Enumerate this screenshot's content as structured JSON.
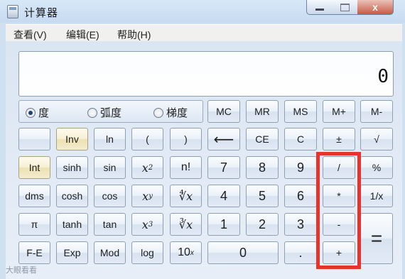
{
  "window": {
    "title": "计算器",
    "controls": {
      "minimize": "",
      "maximize": "",
      "close": "x"
    }
  },
  "menu": [
    "查看(V)",
    "编辑(E)",
    "帮助(H)"
  ],
  "display": {
    "value": "0"
  },
  "mode": {
    "options": [
      "度",
      "弧度",
      "梯度"
    ],
    "selected": "度"
  },
  "memory_row": [
    "MC",
    "MR",
    "MS",
    "M+",
    "M-"
  ],
  "keys": {
    "blank": "",
    "inv": "Inv",
    "ln": "ln",
    "lparen": "(",
    "rparen": ")",
    "backspace": "⟵",
    "ce": "CE",
    "c": "C",
    "plusminus": "±",
    "sqrt": "√",
    "int": "Int",
    "sinh": "sinh",
    "sin": "sin",
    "x2": "x",
    "x2_sup": "2",
    "nfact": "n!",
    "d7": "7",
    "d8": "8",
    "d9": "9",
    "divide": "/",
    "percent": "%",
    "dms": "dms",
    "cosh": "cosh",
    "cos": "cos",
    "xy": "x",
    "xy_sup": "y",
    "yroot": "∜x",
    "d4": "4",
    "d5": "5",
    "d6": "6",
    "multiply": "*",
    "reciprocal": "1/x",
    "pi": "π",
    "tanh": "tanh",
    "tan": "tan",
    "x3": "x",
    "x3_sup": "3",
    "cuberoot": "∛x",
    "d1": "1",
    "d2": "2",
    "d3": "3",
    "minus": "-",
    "equals": "=",
    "fe": "F-E",
    "exp": "Exp",
    "mod": "Mod",
    "log": "log",
    "tenx": "10",
    "tenx_sup": "x",
    "d0": "0",
    "dot": ".",
    "plus": "+"
  },
  "watermark": "大眼看看",
  "colors": {
    "highlight": "#e8332c",
    "window": "#cfe0f1"
  }
}
